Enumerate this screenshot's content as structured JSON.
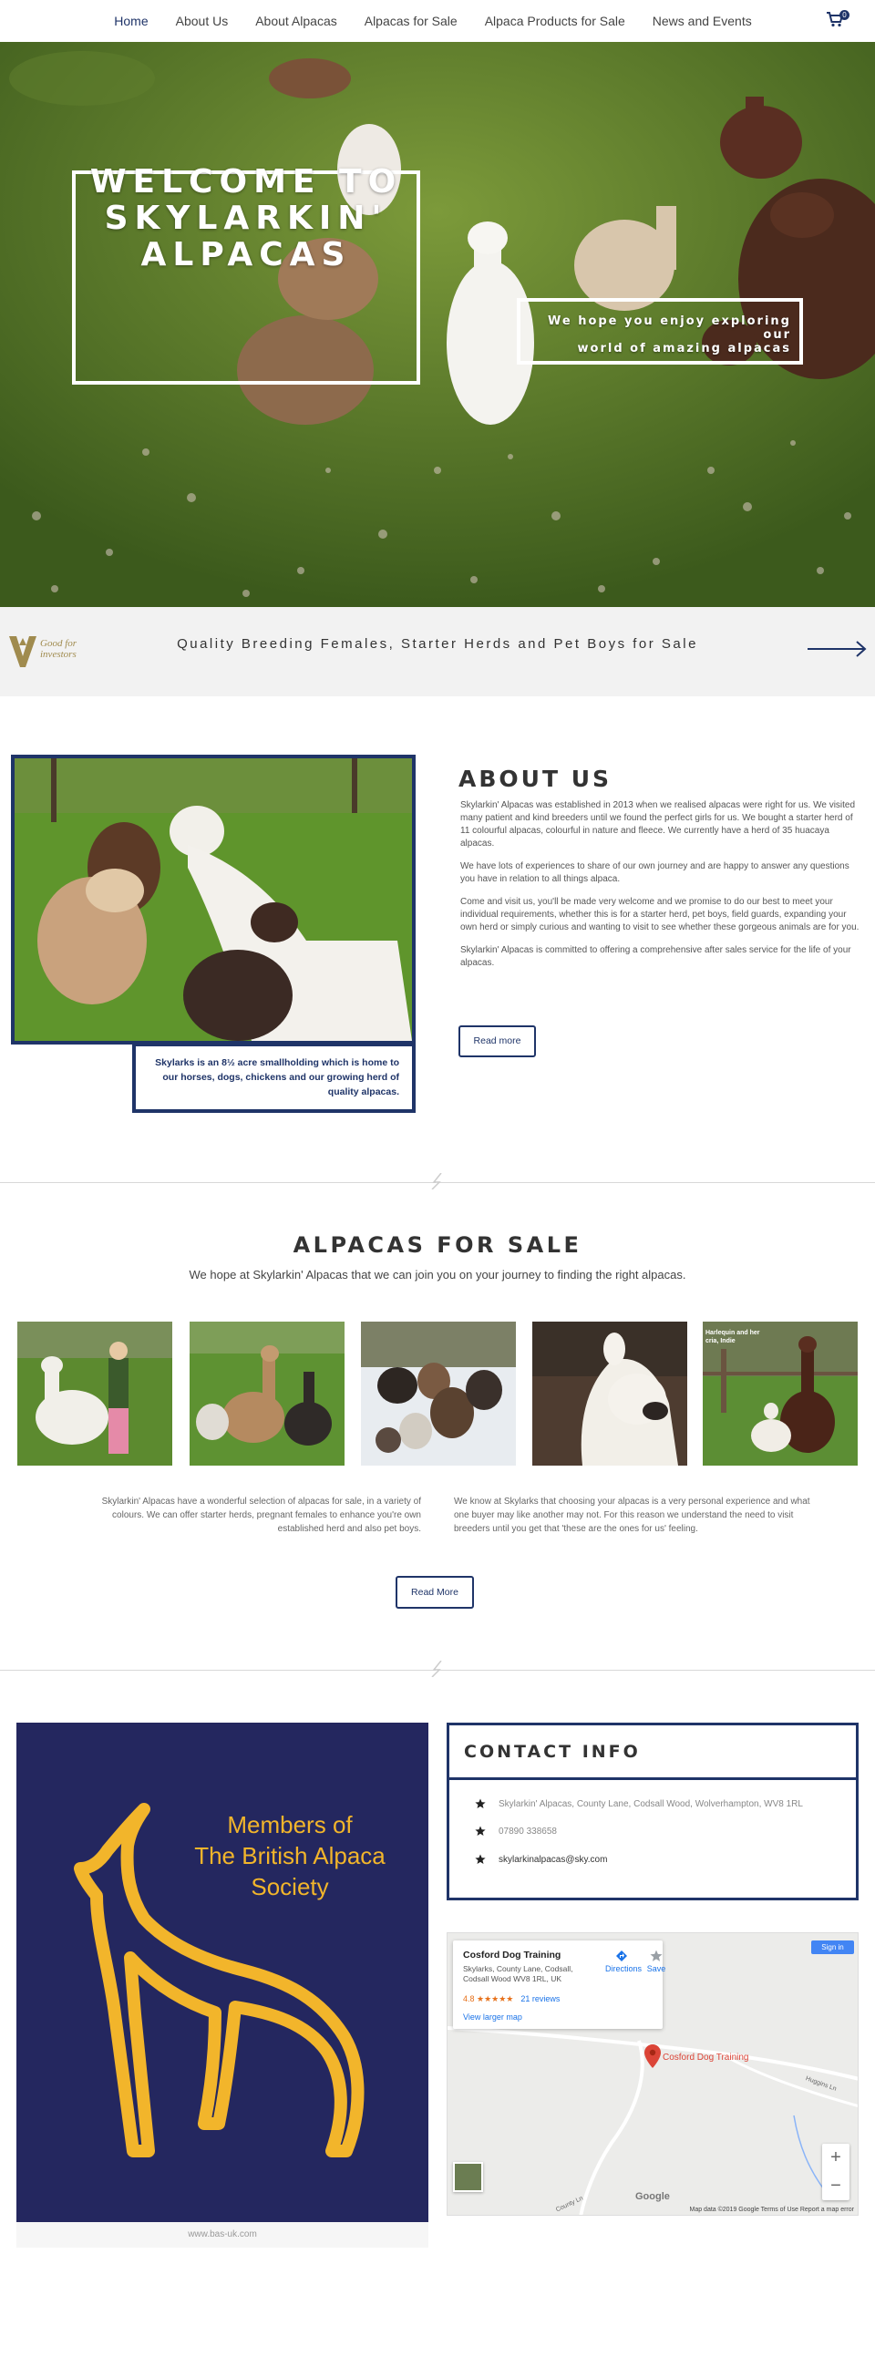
{
  "nav": {
    "items": [
      {
        "label": "Home",
        "active": true
      },
      {
        "label": "About Us"
      },
      {
        "label": "About Alpacas"
      },
      {
        "label": "Alpacas for Sale"
      },
      {
        "label": "Alpaca Products for Sale"
      },
      {
        "label": "News and Events"
      }
    ],
    "cart_count": "0"
  },
  "hero": {
    "title_lines": [
      "WELCOME TO",
      "SKYLARKIN'",
      "ALPACAS"
    ],
    "subtitle_lines": [
      "We hope you enjoy exploring our",
      "world of amazing alpacas"
    ]
  },
  "strip": {
    "logo_text_1": "Good for",
    "logo_text_2": "investors",
    "text": "Quality Breeding Females, Starter Herds and Pet Boys for Sale"
  },
  "about": {
    "caption": "Skylarks is an 8½ acre smallholding which is home to our horses, dogs, chickens and our growing herd of quality alpacas.",
    "title": "ABOUT US",
    "paragraphs": [
      "Skylarkin' Alpacas was established in 2013 when we realised alpacas were right for us. We visited many patient and kind breeders until we found the perfect girls for us. We bought a starter herd of 11 colourful alpacas, colourful in nature and fleece. We currently have a herd of 35 huacaya alpacas.",
      "We have lots of experiences to share of our own journey and are happy to answer any questions you have in relation to all things alpaca.",
      "Come and visit us, you'll be made very welcome and we promise to do our best to meet your individual requirements, whether this is for a starter herd, pet boys, field guards, expanding your own herd or simply curious and wanting to visit to see whether these gorgeous animals are for you.",
      "Skylarkin' Alpacas is committed to offering a comprehensive after sales service for the life of your alpacas."
    ],
    "button": "Read more"
  },
  "sale": {
    "title": "ALPACAS FOR SALE",
    "subtitle": "We hope at Skylarkin' Alpacas that we can join you on your journey to finding the right alpacas.",
    "thumb_caption": "Harlequin and her cria, Indie",
    "col1": "Skylarkin' Alpacas have a wonderful selection of alpacas for sale, in a variety of colours. We can offer starter herds, pregnant females to enhance you're own established herd and also pet boys.",
    "col2": "We know at Skylarks that choosing your alpacas is a very personal experience and what one buyer may like another may not. For this reason we understand the need to visit breeders until you get that 'these are the ones for us' feeling.",
    "button": "Read More"
  },
  "bas": {
    "text_lines": [
      "Members of",
      "The British Alpaca",
      "Society"
    ],
    "caption": "www.bas-uk.com"
  },
  "contact": {
    "title": "CONTACT INFO",
    "address": "Skylarkin' Alpacas, County Lane, Codsall Wood, Wolverhampton, WV8 1RL",
    "phone": "07890 338658",
    "email": "skylarkinalpacas@sky.com"
  },
  "map": {
    "place": "Cosford Dog Training",
    "address": "Skylarks, County Lane, Codsall, Codsall Wood WV8 1RL, UK",
    "rating": "4.8 ★★★★★",
    "reviews": "21 reviews",
    "directions": "Directions",
    "save": "Save",
    "larger": "View larger map",
    "signin": "Sign in",
    "pin_label": "Cosford Dog Training",
    "road_1": "Huggins Ln",
    "road_2": "County Ln",
    "google": "Google",
    "footer": "Map data ©2019 Google    Terms of Use    Report a map error"
  }
}
